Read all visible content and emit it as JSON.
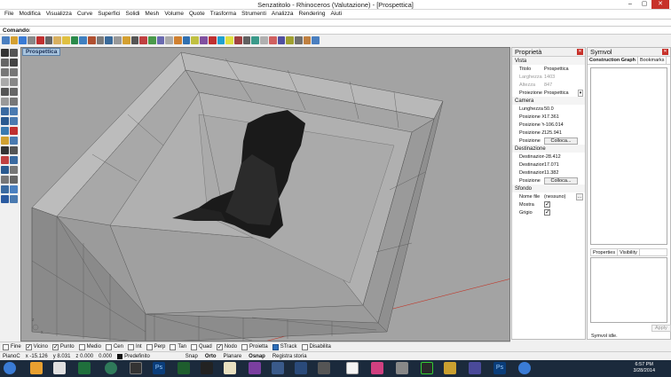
{
  "window": {
    "title": "Senzatitolo - Rhinoceros (Valutazione) - [Prospettica]",
    "controls": [
      "–",
      "▢",
      "✕"
    ]
  },
  "menu": [
    "File",
    "Modifica",
    "Visualizza",
    "Curve",
    "Superfici",
    "Solidi",
    "Mesh",
    "Volume",
    "Quote",
    "Trasforma",
    "Strumenti",
    "Analizza",
    "Rendering",
    "Aiuti"
  ],
  "command": {
    "label": "Comando:",
    "value": ""
  },
  "viewport": {
    "tab": "Prospettica",
    "background": "#a3a3a3",
    "axis_labels": [
      "z",
      "x"
    ]
  },
  "osnap": [
    {
      "label": "Fine",
      "checked": false
    },
    {
      "label": "Vicino",
      "checked": true
    },
    {
      "label": "Punto",
      "checked": true
    },
    {
      "label": "Medio",
      "checked": false
    },
    {
      "label": "Cen",
      "checked": false
    },
    {
      "label": "Int",
      "checked": false
    },
    {
      "label": "Perp",
      "checked": false
    },
    {
      "label": "Tan",
      "checked": false
    },
    {
      "label": "Quad",
      "checked": false
    },
    {
      "label": "Nodo",
      "checked": true
    },
    {
      "label": "Proietta",
      "checked": false
    },
    {
      "label": "STrack",
      "checked": false
    },
    {
      "label": "Disabilita",
      "checked": false
    }
  ],
  "status": {
    "plane": "PianoC",
    "x": "x -15.126",
    "y": "y 8.031",
    "z": "z 0.000",
    "dist": "0.000",
    "layer": "Predefinito",
    "toggles": [
      {
        "label": "Snap",
        "bold": false
      },
      {
        "label": "Orto",
        "bold": true
      },
      {
        "label": "Planare",
        "bold": false
      },
      {
        "label": "Osnap",
        "bold": true
      },
      {
        "label": "Registra storia",
        "bold": false
      }
    ]
  },
  "properties": {
    "title": "Proprietà",
    "sections": [
      {
        "name": "Vista",
        "rows": [
          {
            "k": "Titolo",
            "v": "Prospettica"
          },
          {
            "k": "Larghezza",
            "v": "1403",
            "grey": true
          },
          {
            "k": "Altezza",
            "v": "847",
            "grey": true
          },
          {
            "k": "Proiezione",
            "v": "Prospettica",
            "select": true
          }
        ]
      },
      {
        "name": "Camera",
        "rows": [
          {
            "k": "Lunghezza f.",
            "v": "50.0"
          },
          {
            "k": "Posizione X",
            "v": "17.361"
          },
          {
            "k": "Posizione Y",
            "v": "-106.014"
          },
          {
            "k": "Posizione Z",
            "v": "125.941"
          },
          {
            "k": "Posizione",
            "v": "Colloca...",
            "button": true
          }
        ]
      },
      {
        "name": "Destinazione",
        "rows": [
          {
            "k": "Destinazion...",
            "v": "-28.412"
          },
          {
            "k": "Destinazion...",
            "v": "17.071"
          },
          {
            "k": "Destinazion...",
            "v": "11.382"
          },
          {
            "k": "Posizione",
            "v": "Colloca...",
            "button": true
          }
        ]
      },
      {
        "name": "Sfondo",
        "rows": [
          {
            "k": "Nome file",
            "v": "(nessuno)",
            "dots": true
          },
          {
            "k": "Mostra",
            "v": "",
            "check": true
          },
          {
            "k": "Grigio",
            "v": "",
            "check": true
          }
        ]
      }
    ]
  },
  "symvol": {
    "title": "Symvol",
    "tabs": [
      "Construction Graph",
      "Bookmarks"
    ],
    "lower_tabs": [
      "Properties",
      "Visibility"
    ],
    "apply": "Apply",
    "status": "Symvol idle."
  },
  "clock": {
    "time": "6:57 PM",
    "date": "3/28/2014"
  },
  "colors": {
    "accent": "#a8c4de",
    "close": "#c7312a",
    "taskbar": "#1b2a3c",
    "axis_red": "#c0392b",
    "axis_green": "#3c9a3c"
  }
}
